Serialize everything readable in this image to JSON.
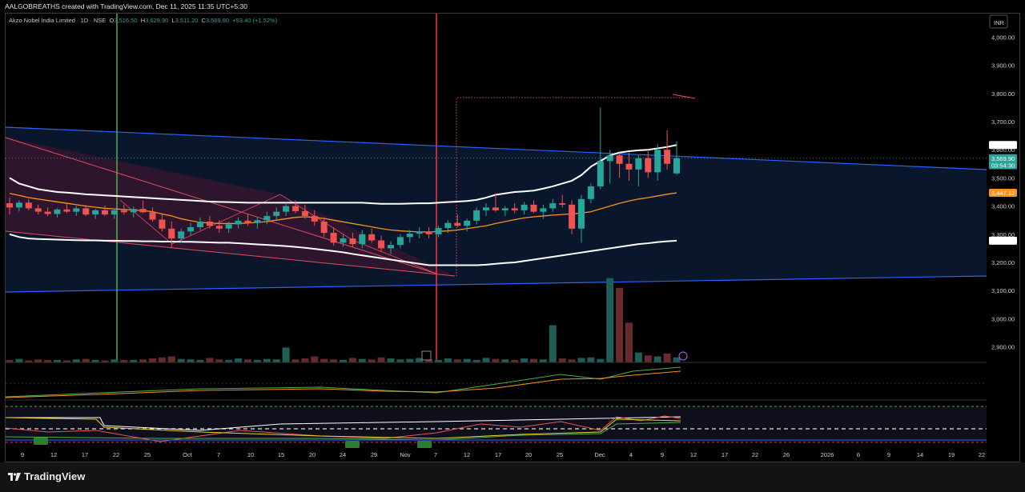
{
  "caption": "AALGOBREATHS created with TradingView.com, Dec 11, 2025 11:35 UTC+5:30",
  "legend": {
    "symbol": "Akzo Nobel India Limited · 1D · NSE",
    "o_label": "O",
    "o": "3,516.50",
    "h_label": "H",
    "h": "3,629.90",
    "l_label": "L",
    "l": "3,511.20",
    "c_label": "C",
    "c": "3,569.90",
    "change": "+53.40 (+1.52%)"
  },
  "currency": "INR",
  "brand": "TradingView",
  "colors": {
    "up": "#26a69a",
    "down": "#ef5350",
    "channel": "#2962ff",
    "ema": "#f7931a",
    "band": "#ffffff",
    "wedge": "#e04c5f",
    "signal": "#e6294a",
    "vline_green": "#4caf50",
    "vline_red": "#f23645"
  },
  "chart_data": {
    "type": "candlestick",
    "title": "Akzo Nobel India Limited · 1D · NSE",
    "ylim": [
      2800,
      4070
    ],
    "y_ticks": [
      "4,000.00",
      "3,900.00",
      "3,800.00",
      "3,700.00",
      "3,600.00",
      "3,500.00",
      "3,400.00",
      "3,300.00",
      "3,200.00",
      "3,100.00",
      "3,000.00",
      "2,900.00"
    ],
    "x_ticks": [
      "9",
      "12",
      "17",
      "22",
      "25",
      "Oct",
      "7",
      "10",
      "15",
      "20",
      "24",
      "29",
      "Nov",
      "7",
      "12",
      "17",
      "20",
      "25",
      "Dec",
      "4",
      "9",
      "12",
      "17",
      "22",
      "26",
      "2026",
      "6",
      "9",
      "14",
      "19",
      "22"
    ],
    "price_labels": [
      {
        "text": "3,617.04",
        "value": 3617,
        "color": "#ffffff",
        "fg": "#000000"
      },
      {
        "text": "3,569.90",
        "value": 3570,
        "color": "#26a69a",
        "fg": "#ffffff"
      },
      {
        "text": "03:54:30",
        "value": 3545,
        "color": "#26a69a",
        "fg": "#ffffff"
      },
      {
        "text": "3,447.12",
        "value": 3447,
        "color": "#f7931a",
        "fg": "#ffffff"
      },
      {
        "text": "3,277.20",
        "value": 3277,
        "color": "#ffffff",
        "fg": "#000000"
      }
    ],
    "candles": [
      [
        3410,
        3430,
        3370,
        3395
      ],
      [
        3395,
        3420,
        3380,
        3412
      ],
      [
        3412,
        3425,
        3385,
        3392
      ],
      [
        3392,
        3405,
        3370,
        3380
      ],
      [
        3380,
        3395,
        3365,
        3372
      ],
      [
        3372,
        3392,
        3360,
        3388
      ],
      [
        3388,
        3410,
        3375,
        3380
      ],
      [
        3380,
        3400,
        3365,
        3392
      ],
      [
        3392,
        3405,
        3365,
        3370
      ],
      [
        3370,
        3390,
        3355,
        3385
      ],
      [
        3385,
        3402,
        3365,
        3370
      ],
      [
        3370,
        3392,
        3355,
        3385
      ],
      [
        3385,
        3405,
        3370,
        3378
      ],
      [
        3378,
        3398,
        3360,
        3390
      ],
      [
        3390,
        3420,
        3375,
        3378
      ],
      [
        3378,
        3395,
        3345,
        3352
      ],
      [
        3352,
        3370,
        3310,
        3320
      ],
      [
        3320,
        3345,
        3250,
        3285
      ],
      [
        3285,
        3320,
        3270,
        3310
      ],
      [
        3310,
        3340,
        3295,
        3325
      ],
      [
        3325,
        3360,
        3315,
        3345
      ],
      [
        3345,
        3365,
        3320,
        3330
      ],
      [
        3330,
        3350,
        3305,
        3320
      ],
      [
        3320,
        3345,
        3305,
        3335
      ],
      [
        3335,
        3360,
        3320,
        3348
      ],
      [
        3348,
        3372,
        3330,
        3340
      ],
      [
        3340,
        3360,
        3320,
        3350
      ],
      [
        3350,
        3380,
        3335,
        3365
      ],
      [
        3365,
        3395,
        3350,
        3380
      ],
      [
        3380,
        3412,
        3365,
        3400
      ],
      [
        3400,
        3420,
        3375,
        3382
      ],
      [
        3382,
        3405,
        3355,
        3365
      ],
      [
        3365,
        3385,
        3330,
        3345
      ],
      [
        3345,
        3360,
        3290,
        3305
      ],
      [
        3305,
        3325,
        3260,
        3270
      ],
      [
        3270,
        3300,
        3255,
        3285
      ],
      [
        3285,
        3305,
        3255,
        3265
      ],
      [
        3265,
        3315,
        3250,
        3300
      ],
      [
        3300,
        3320,
        3270,
        3278
      ],
      [
        3278,
        3295,
        3240,
        3250
      ],
      [
        3250,
        3275,
        3230,
        3262
      ],
      [
        3262,
        3300,
        3250,
        3290
      ],
      [
        3290,
        3315,
        3270,
        3302
      ],
      [
        3302,
        3325,
        3285,
        3310
      ],
      [
        3310,
        3325,
        3285,
        3300
      ],
      [
        3300,
        3330,
        3290,
        3322
      ],
      [
        3322,
        3350,
        3305,
        3340
      ],
      [
        3340,
        3370,
        3325,
        3330
      ],
      [
        3330,
        3355,
        3310,
        3348
      ],
      [
        3348,
        3395,
        3335,
        3385
      ],
      [
        3385,
        3410,
        3365,
        3395
      ],
      [
        3395,
        3445,
        3380,
        3385
      ],
      [
        3385,
        3400,
        3365,
        3392
      ],
      [
        3392,
        3410,
        3375,
        3385
      ],
      [
        3385,
        3415,
        3370,
        3405
      ],
      [
        3405,
        3420,
        3375,
        3380
      ],
      [
        3380,
        3405,
        3355,
        3392
      ],
      [
        3392,
        3425,
        3380,
        3410
      ],
      [
        3410,
        3440,
        3395,
        3405
      ],
      [
        3405,
        3420,
        3300,
        3320
      ],
      [
        3320,
        3440,
        3270,
        3425
      ],
      [
        3425,
        3480,
        3410,
        3470
      ],
      [
        3470,
        3750,
        3460,
        3560
      ],
      [
        3560,
        3600,
        3480,
        3580
      ],
      [
        3580,
        3590,
        3500,
        3550
      ],
      [
        3550,
        3590,
        3490,
        3530
      ],
      [
        3530,
        3580,
        3470,
        3570
      ],
      [
        3570,
        3600,
        3500,
        3520
      ],
      [
        3520,
        3620,
        3490,
        3600
      ],
      [
        3600,
        3670,
        3530,
        3550
      ],
      [
        3516,
        3630,
        3511,
        3570
      ]
    ],
    "volume": [
      5,
      7,
      4,
      6,
      5,
      5,
      4,
      6,
      7,
      5,
      4,
      6,
      5,
      5,
      6,
      8,
      10,
      12,
      7,
      6,
      5,
      9,
      6,
      5,
      8,
      6,
      5,
      7,
      6,
      30,
      6,
      8,
      12,
      7,
      6,
      5,
      9,
      7,
      6,
      10,
      8,
      6,
      7,
      9,
      6,
      5,
      8,
      6,
      7,
      5,
      9,
      7,
      6,
      5,
      8,
      7,
      6,
      75,
      8,
      6,
      9,
      10,
      7,
      170,
      150,
      80,
      20,
      14,
      12,
      18,
      10
    ],
    "series": [
      {
        "name": "upper band",
        "values": [
          3500,
          3480,
          3470,
          3460,
          3455,
          3450,
          3448,
          3445,
          3442,
          3440,
          3438,
          3436,
          3434,
          3432,
          3430,
          3428,
          3426,
          3424,
          3422,
          3420,
          3418,
          3416,
          3415,
          3414,
          3413,
          3412,
          3412,
          3412,
          3412,
          3412,
          3412,
          3412,
          3412,
          3412,
          3412,
          3412,
          3412,
          3412,
          3410,
          3408,
          3408,
          3408,
          3409,
          3410,
          3410,
          3412,
          3414,
          3416,
          3418,
          3422,
          3430,
          3440,
          3445,
          3450,
          3452,
          3455,
          3462,
          3470,
          3480,
          3490,
          3510,
          3540,
          3560,
          3580,
          3590,
          3595,
          3598,
          3600,
          3605,
          3610,
          3617
        ]
      },
      {
        "name": "lower band",
        "values": [
          3300,
          3290,
          3285,
          3283,
          3282,
          3281,
          3280,
          3279,
          3278,
          3278,
          3277,
          3277,
          3276,
          3276,
          3275,
          3275,
          3274,
          3274,
          3273,
          3273,
          3272,
          3271,
          3270,
          3270,
          3268,
          3266,
          3264,
          3262,
          3260,
          3258,
          3255,
          3252,
          3248,
          3244,
          3240,
          3236,
          3230,
          3225,
          3220,
          3215,
          3210,
          3205,
          3200,
          3195,
          3190,
          3190,
          3190,
          3190,
          3190,
          3190,
          3192,
          3195,
          3198,
          3200,
          3205,
          3210,
          3215,
          3220,
          3225,
          3230,
          3235,
          3240,
          3245,
          3250,
          3255,
          3260,
          3265,
          3268,
          3272,
          3275,
          3277
        ]
      },
      {
        "name": "ema",
        "values": [
          3445,
          3438,
          3430,
          3425,
          3420,
          3415,
          3410,
          3405,
          3400,
          3396,
          3392,
          3390,
          3388,
          3386,
          3384,
          3380,
          3372,
          3365,
          3355,
          3348,
          3342,
          3340,
          3338,
          3338,
          3338,
          3340,
          3342,
          3345,
          3350,
          3355,
          3360,
          3362,
          3360,
          3356,
          3350,
          3344,
          3338,
          3332,
          3326,
          3320,
          3315,
          3312,
          3310,
          3308,
          3308,
          3310,
          3312,
          3315,
          3320,
          3325,
          3330,
          3338,
          3345,
          3352,
          3358,
          3362,
          3365,
          3368,
          3370,
          3372,
          3375,
          3380,
          3390,
          3400,
          3410,
          3418,
          3425,
          3430,
          3436,
          3442,
          3447
        ]
      }
    ]
  }
}
